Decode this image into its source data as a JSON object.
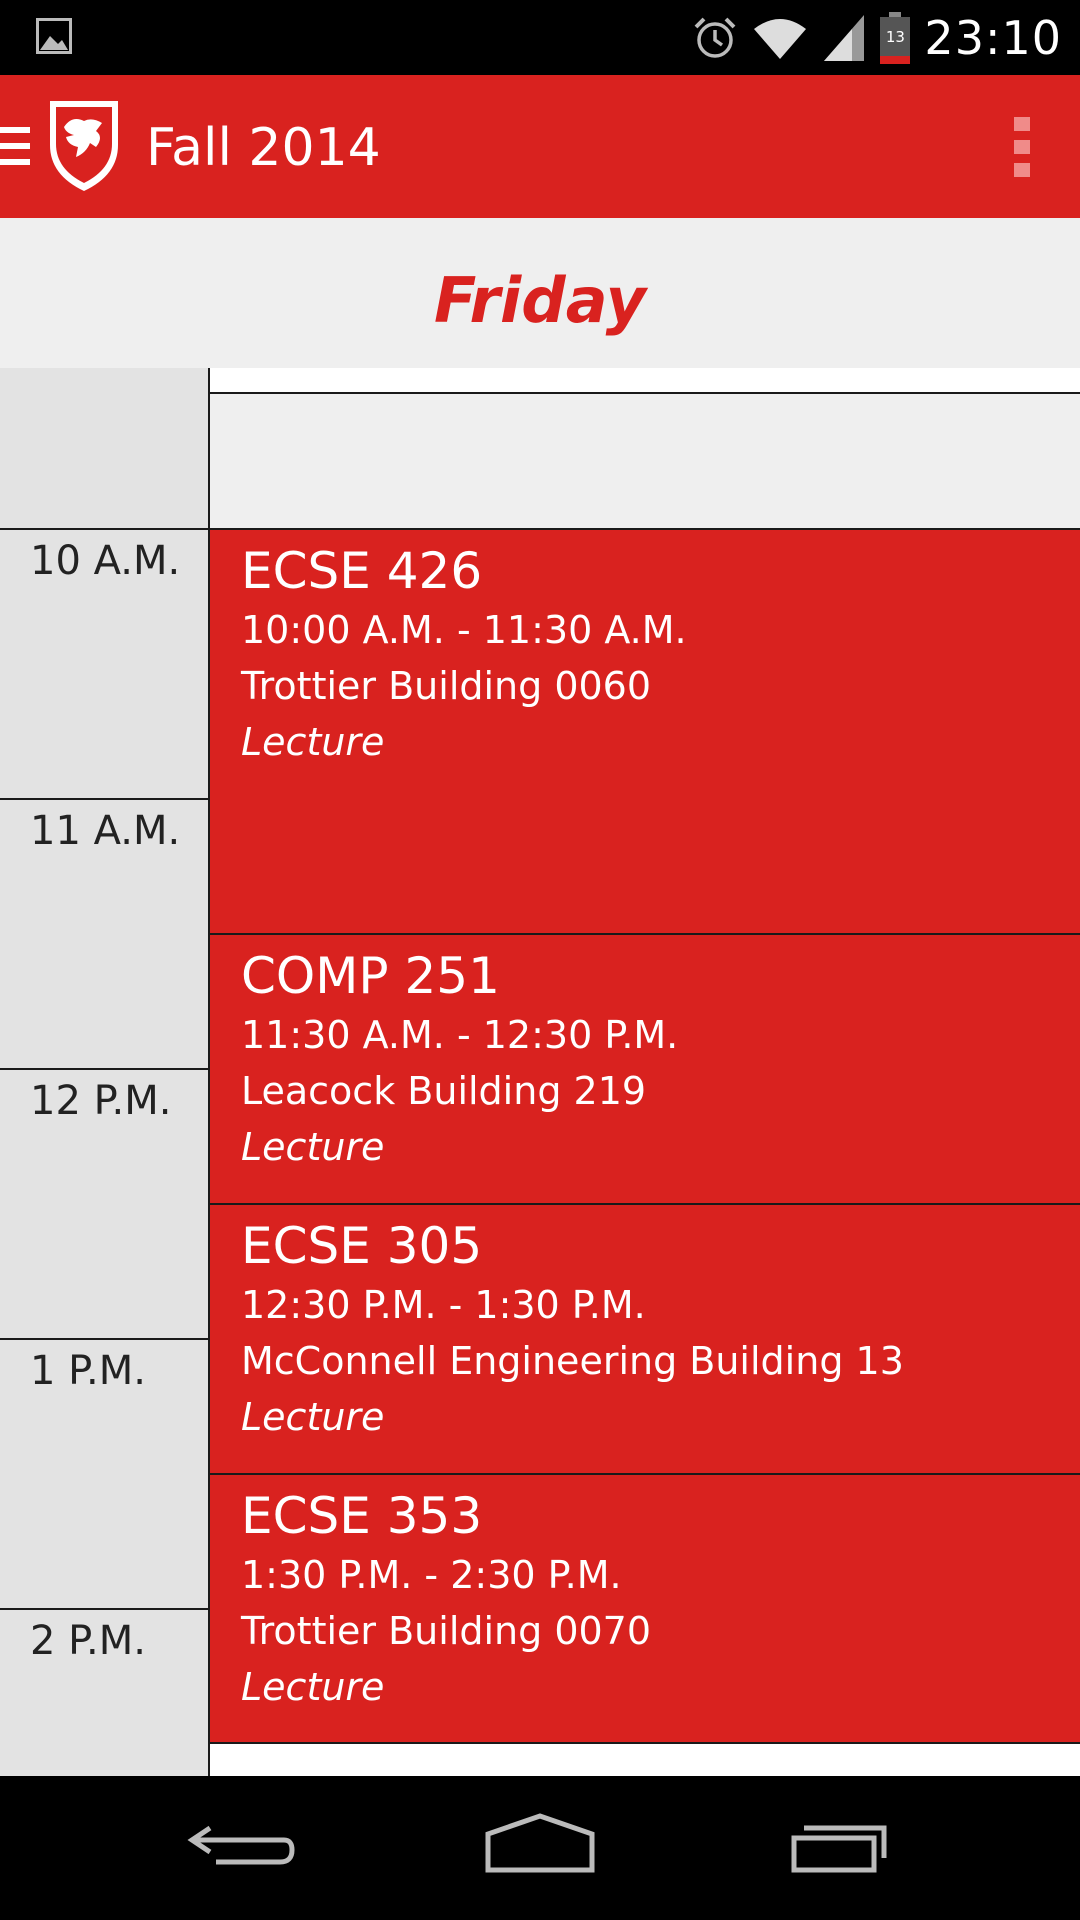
{
  "status_bar": {
    "time": "23:10",
    "battery_level": "13",
    "icons": [
      "image-notification-icon",
      "alarm-icon",
      "wifi-icon",
      "cell-signal-icon",
      "battery-icon"
    ]
  },
  "app_bar": {
    "title": "Fall 2014",
    "menu_icon": "hamburger-menu-icon",
    "logo": "mcgill-shield-logo",
    "overflow_icon": "overflow-menu-icon"
  },
  "day": {
    "title": "Friday"
  },
  "time_labels": [
    "10 A.M.",
    "11 A.M.",
    "12 P.M.",
    "1 P.M.",
    "2 P.M."
  ],
  "events": [
    {
      "course": "ECSE 426",
      "time": "10:00 A.M. - 11:30 A.M.",
      "location": "Trottier Building 0060",
      "type": "Lecture"
    },
    {
      "course": "COMP 251",
      "time": "11:30 A.M. - 12:30 P.M.",
      "location": "Leacock Building 219",
      "type": "Lecture"
    },
    {
      "course": "ECSE 305",
      "time": "12:30 P.M. - 1:30 P.M.",
      "location": "McConnell Engineering Building 13",
      "type": "Lecture"
    },
    {
      "course": "ECSE 353",
      "time": "1:30 P.M. - 2:30 P.M.",
      "location": "Trottier Building 0070",
      "type": "Lecture"
    }
  ],
  "colors": {
    "accent": "#d9221f",
    "header_bg": "#efefef",
    "time_column_bg": "#e3e3e3"
  },
  "nav_bar": {
    "icons": [
      "back-icon",
      "home-icon",
      "recent-apps-icon"
    ]
  }
}
